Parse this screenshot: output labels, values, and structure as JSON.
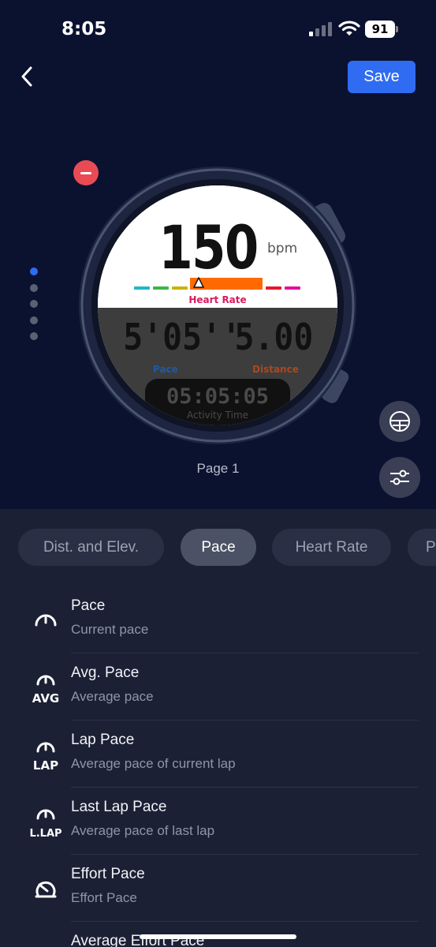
{
  "status_bar": {
    "time": "8:05",
    "battery": "91"
  },
  "header": {
    "save_label": "Save"
  },
  "watch_face": {
    "heart_rate_value": "150",
    "heart_rate_unit": "bpm",
    "heart_rate_label": "Heart Rate",
    "pace_value": "5'05''",
    "pace_label": "Pace",
    "distance_value": "5.00",
    "distance_label": "Distance",
    "time_value": "05:05:05",
    "time_label": "Activity Time"
  },
  "page_indicator": {
    "label": "Page 1",
    "total_pages": 5,
    "current_page": 1
  },
  "colors": {
    "accent": "#2f6cf2",
    "remove": "#e94b55",
    "background_top": "#0b1230",
    "background_bottom": "#1b2035",
    "heart_rate_label": "#d81b60",
    "pace_label": "#1e5aa8",
    "distance_label": "#b0461a"
  },
  "tabs": [
    {
      "label": "Dist. and Elev.",
      "active": false
    },
    {
      "label": "Pace",
      "active": true
    },
    {
      "label": "Heart Rate",
      "active": false
    },
    {
      "label": "P",
      "active": false
    }
  ],
  "list": [
    {
      "title": "Pace",
      "subtitle": "Current pace",
      "icon": "gauge-icon"
    },
    {
      "title": "Avg. Pace",
      "subtitle": "Average pace",
      "icon": "gauge-avg-icon",
      "badge": "AVG"
    },
    {
      "title": "Lap Pace",
      "subtitle": "Average pace of current lap",
      "icon": "gauge-lap-icon",
      "badge": "LAP"
    },
    {
      "title": "Last Lap Pace",
      "subtitle": "Average pace of last lap",
      "icon": "gauge-last-lap-icon",
      "badge": "L.LAP"
    },
    {
      "title": "Effort Pace",
      "subtitle": "Effort Pace",
      "icon": "effort-gauge-icon"
    },
    {
      "title": "Average Effort Pace",
      "subtitle": "",
      "icon": "effort-gauge-icon"
    }
  ]
}
